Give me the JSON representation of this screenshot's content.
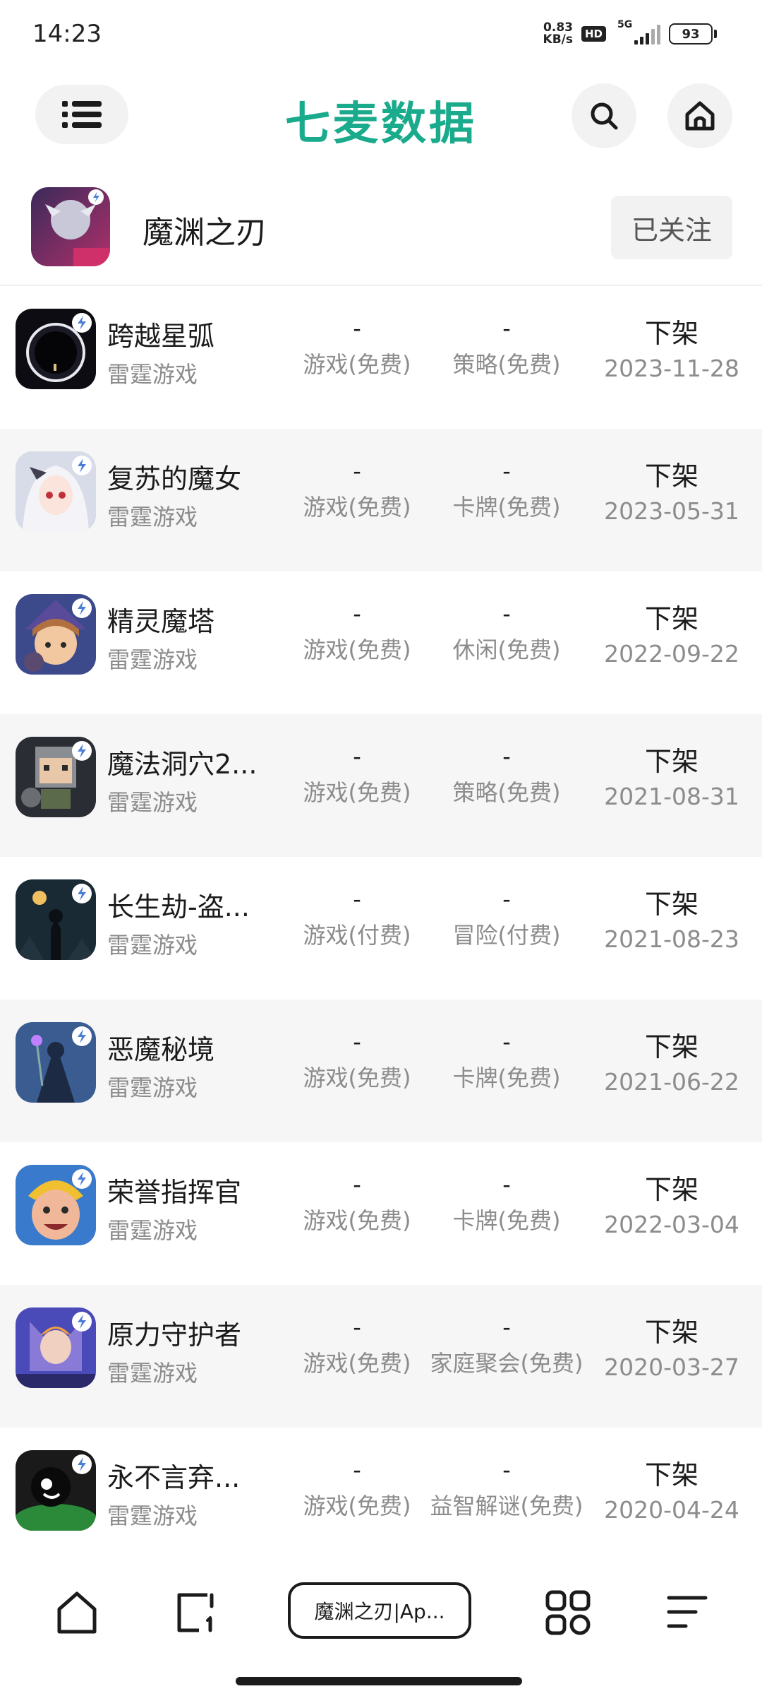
{
  "status": {
    "time": "14:23",
    "speed_value": "0.83",
    "speed_unit": "KB/s",
    "hd": "HD",
    "network": "5G",
    "battery": "93"
  },
  "header": {
    "logo": "七麦数据",
    "accent_color": "#1aaa8c"
  },
  "app": {
    "title": "魔渊之刃",
    "follow_label": "已关注"
  },
  "rows": [
    {
      "name": "跨越星弧",
      "developer": "雷霆游戏",
      "rank1": "-",
      "category1": "游戏(免费)",
      "rank2": "-",
      "category2": "策略(免费)",
      "status": "下架",
      "date": "2023-11-28"
    },
    {
      "name": "复苏的魔女",
      "developer": "雷霆游戏",
      "rank1": "-",
      "category1": "游戏(免费)",
      "rank2": "-",
      "category2": "卡牌(免费)",
      "status": "下架",
      "date": "2023-05-31"
    },
    {
      "name": "精灵魔塔",
      "developer": "雷霆游戏",
      "rank1": "-",
      "category1": "游戏(免费)",
      "rank2": "-",
      "category2": "休闲(免费)",
      "status": "下架",
      "date": "2022-09-22"
    },
    {
      "name": "魔法洞穴2...",
      "developer": "雷霆游戏",
      "rank1": "-",
      "category1": "游戏(免费)",
      "rank2": "-",
      "category2": "策略(免费)",
      "status": "下架",
      "date": "2021-08-31"
    },
    {
      "name": "长生劫-盗...",
      "developer": "雷霆游戏",
      "rank1": "-",
      "category1": "游戏(付费)",
      "rank2": "-",
      "category2": "冒险(付费)",
      "status": "下架",
      "date": "2021-08-23"
    },
    {
      "name": "恶魔秘境",
      "developer": "雷霆游戏",
      "rank1": "-",
      "category1": "游戏(免费)",
      "rank2": "-",
      "category2": "卡牌(免费)",
      "status": "下架",
      "date": "2021-06-22"
    },
    {
      "name": "荣誉指挥官",
      "developer": "雷霆游戏",
      "rank1": "-",
      "category1": "游戏(免费)",
      "rank2": "-",
      "category2": "卡牌(免费)",
      "status": "下架",
      "date": "2022-03-04"
    },
    {
      "name": "原力守护者",
      "developer": "雷霆游戏",
      "rank1": "-",
      "category1": "游戏(免费)",
      "rank2": "-",
      "category2": "家庭聚会(免费)",
      "status": "下架",
      "date": "2020-03-27"
    },
    {
      "name": "永不言弃...",
      "developer": "雷霆游戏",
      "rank1": "-",
      "category1": "游戏(免费)",
      "rank2": "-",
      "category2": "益智解谜(免费)",
      "status": "下架",
      "date": "2020-04-24"
    }
  ],
  "bottom_nav": {
    "url_label": "魔渊之刃|Ap..."
  }
}
